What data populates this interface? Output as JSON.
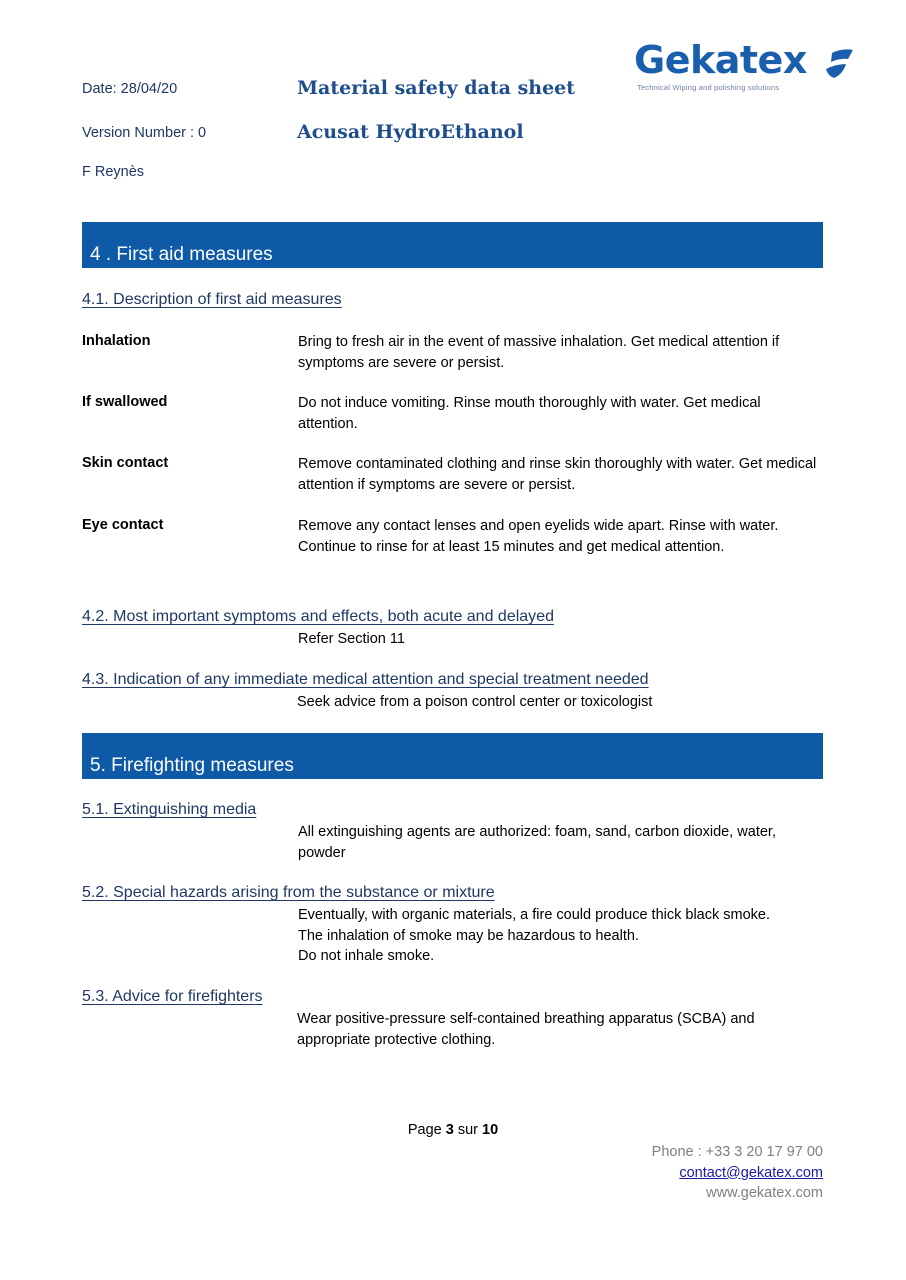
{
  "header": {
    "date": "Date: 28/04/20",
    "version": "Version Number : 0",
    "author": "F Reynès",
    "doc_title": "Material safety data sheet",
    "product_name": "Acusat HydroEthanol"
  },
  "logo": {
    "wordmark": "Gekatex",
    "tagline": "Technical Wiping and polishing solutions",
    "brand_color": "#1a5fae"
  },
  "section4": {
    "title": "4 . First aid measures",
    "band_color": "#0e5aa7",
    "sub1": {
      "heading": "4.1. Description of first aid measures",
      "rows": [
        {
          "label": "Inhalation",
          "text": "Bring to fresh air in the event of massive inhalation. Get medical attention if symptoms are severe or persist."
        },
        {
          "label": "If swallowed",
          "text": "Do not induce vomiting. Rinse mouth thoroughly with water. Get medical attention."
        },
        {
          "label": "Skin contact",
          "text": "Remove contaminated clothing and rinse skin thoroughly with water. Get medical attention if symptoms are severe or persist."
        },
        {
          "label": "Eye contact",
          "text": "Remove any contact lenses and open eyelids wide apart. Rinse with water. Continue to rinse for at least 15 minutes and get medical attention."
        }
      ]
    },
    "sub2": {
      "heading": "4.2. Most important symptoms and effects, both acute and delayed",
      "text": "Refer Section 11"
    },
    "sub3": {
      "heading": "4.3. Indication of any immediate medical attention and special treatment needed",
      "text": "Seek advice from a poison control center or toxicologist"
    }
  },
  "section5": {
    "title": "5. Firefighting measures",
    "sub1": {
      "heading": "5.1. Extinguishing media",
      "text": "All extinguishing agents are authorized: foam, sand, carbon dioxide, water, powder"
    },
    "sub2": {
      "heading": "5.2. Special hazards arising from the substance or mixture",
      "lines": [
        "Eventually, with organic materials, a fire could produce thick black smoke.",
        "The inhalation of smoke may be hazardous to health.",
        "Do not inhale smoke."
      ]
    },
    "sub3": {
      "heading": "5.3. Advice for firefighters",
      "text": "Wear positive-pressure self-contained breathing apparatus (SCBA) and appropriate protective clothing."
    }
  },
  "footer": {
    "page_prefix": "Page ",
    "page_current": "3",
    "page_sep": " sur ",
    "page_total": "10",
    "phone": "Phone : +33 3 20 17 97 00",
    "email": "contact@gekatex.com",
    "website": "www.gekatex.com"
  }
}
